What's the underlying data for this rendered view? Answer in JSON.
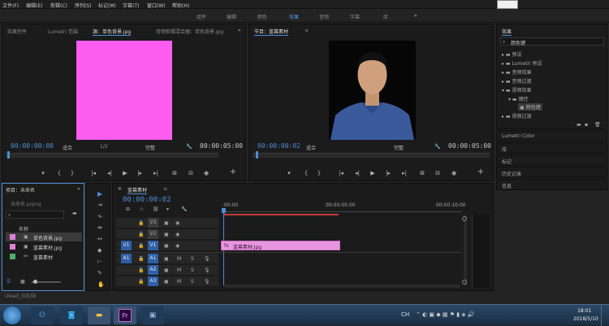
{
  "menu": [
    "文件(F)",
    "编辑(E)",
    "剪辑(C)",
    "序列(S)",
    "标记(M)",
    "字幕(T)",
    "窗口(W)",
    "帮助(H)"
  ],
  "workspaces": [
    "组件",
    "编辑",
    "颜色",
    "效果",
    "音频",
    "字幕",
    "库"
  ],
  "workspace_more": "»",
  "source": {
    "tabs": [
      "效果控件",
      "Lumetri 范围",
      "源：单色背景.jpg",
      "音频剪辑混合器：单色背景.jpg"
    ],
    "more": "»",
    "timecode_in": "00:00:00:00",
    "fit": "适合",
    "page": "1/2",
    "full": "完整",
    "timecode_out": "00:00:05:00",
    "clip_color": "#ff5cf0"
  },
  "program": {
    "tab": "节目：蓝幕素材",
    "menu_icon": "≡",
    "timecode_in": "00:00:00:02",
    "fit": "适合",
    "full": "完整",
    "timecode_out": "00:00:05:00"
  },
  "effects": {
    "tab": "效果",
    "search_value": "颜色键",
    "items": [
      "预设",
      "Lumetri 预设",
      "音频效果",
      "音频过渡",
      "视频效果",
      "键控",
      "颜色键",
      "视频过渡"
    ],
    "side_panels": [
      "Lumetri Color",
      "库",
      "标记",
      "历史记录",
      "信息"
    ]
  },
  "project": {
    "title": "项目：未命名",
    "file": "未命名.prproj",
    "name_header": "名称",
    "items": [
      {
        "name": "单色背景.jpg",
        "color": "#e07fd8"
      },
      {
        "name": "蓝幕素材.jpg",
        "color": "#e07fd8"
      },
      {
        "name": "蓝幕素材",
        "color": "#4cae6b"
      }
    ],
    "status": "Ulead_GifJ3B"
  },
  "timeline": {
    "tab": "蓝幕素材",
    "timecode": "00:00:00:02",
    "ruler": [
      ":00:00",
      "00:00:05:00",
      "00:00:10:00"
    ],
    "video_tracks": [
      "V3",
      "V2",
      "V1"
    ],
    "audio_tracks": [
      "A1",
      "A2",
      "A3"
    ],
    "source_patch_v": "V1",
    "source_patch_a": "A1",
    "clip_label": "蓝幕素材.jpg",
    "clip_color": "#e895e0"
  },
  "taskbar": {
    "apps": [
      "windows-start",
      "mindmap-app",
      "qq-app",
      "explorer-app",
      "premiere-app",
      "media-app"
    ],
    "pr_label": "Pr",
    "lang": "CH",
    "time": "18:01",
    "date": "2018/5/10"
  }
}
